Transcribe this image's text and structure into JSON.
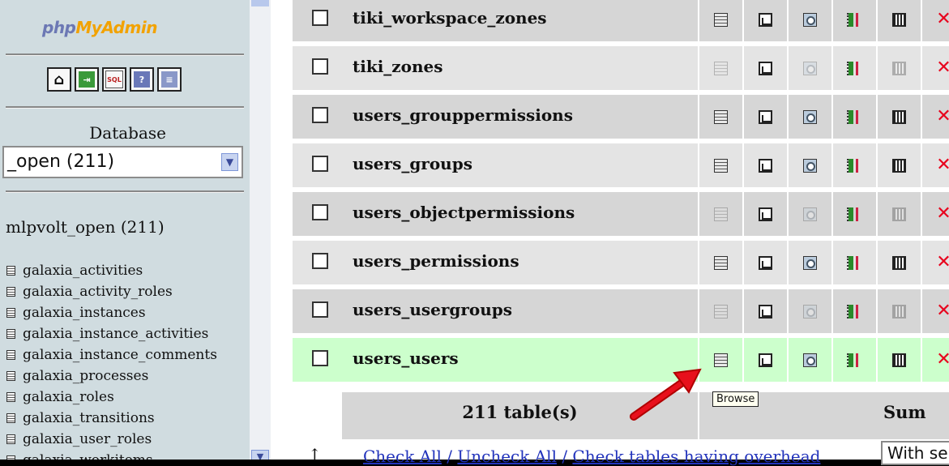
{
  "sidebar": {
    "logo": {
      "part1": "php",
      "part2": "MyAdmin"
    },
    "icon_buttons": [
      {
        "icon": "home-icon",
        "glyph": "⌂"
      },
      {
        "icon": "exit-icon",
        "glyph": "⇥"
      },
      {
        "icon": "sql-icon",
        "glyph": "SQL"
      },
      {
        "icon": "help-icon",
        "glyph": "?"
      },
      {
        "icon": "docs-icon",
        "glyph": "≡"
      }
    ],
    "database_label": "Database",
    "database_select_value": "_open (211)",
    "database_name": "mlpvolt_open (211)",
    "tables": [
      "galaxia_activities",
      "galaxia_activity_roles",
      "galaxia_instances",
      "galaxia_instance_activities",
      "galaxia_instance_comments",
      "galaxia_processes",
      "galaxia_roles",
      "galaxia_transitions",
      "galaxia_user_roles",
      "galaxia_workitems"
    ]
  },
  "main": {
    "rows": [
      {
        "name": "tiki_workspace_zones",
        "dimmed": false
      },
      {
        "name": "tiki_zones",
        "dimmed": true
      },
      {
        "name": "users_grouppermissions",
        "dimmed": false
      },
      {
        "name": "users_groups",
        "dimmed": false
      },
      {
        "name": "users_objectpermissions",
        "dimmed": true
      },
      {
        "name": "users_permissions",
        "dimmed": false
      },
      {
        "name": "users_usergroups",
        "dimmed": true
      },
      {
        "name": "users_users",
        "dimmed": false
      }
    ],
    "footer": {
      "count": "211 table(s)",
      "sum": "Sum"
    },
    "tooltip": "Browse",
    "check_links": {
      "check_all": "Check All",
      "uncheck_all": "Uncheck All",
      "check_overhead": "Check tables having overhead",
      "separator": " / "
    },
    "with_selected": "With se",
    "accent_color": "#e8001c",
    "highlight_row_color": "#ccffcc"
  }
}
